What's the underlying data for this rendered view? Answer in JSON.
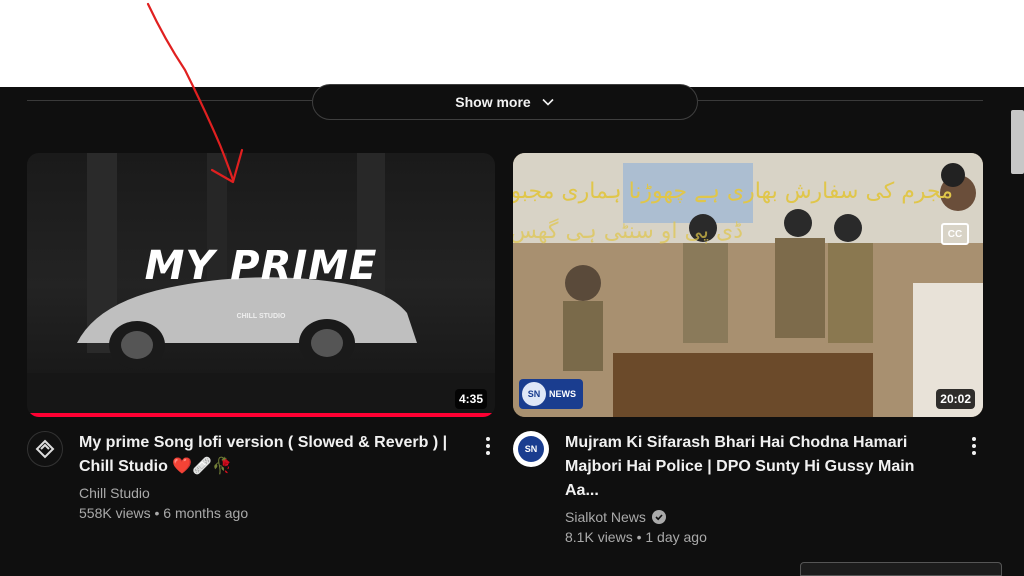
{
  "show_more": {
    "label": "Show more",
    "icon": "chevron-down-icon"
  },
  "videos": [
    {
      "thumbnail_title": "MY PRIME",
      "thumbnail_subtitle": "CHILL STUDIO",
      "duration": "4:35",
      "watched_progress_percent": 100,
      "title": "My prime Song lofi version ( Slowed & Reverb ) | Chill Studio ❤️🩹🥀",
      "channel": "Chill Studio",
      "verified": false,
      "stats": "558K views • 6 months ago"
    },
    {
      "thumbnail_text_line1": "مجرم کی سفارش بھاری ہے چھوڑنا ہماری مجبوری ہے پولیس",
      "thumbnail_text_line2": "ڈی پی او سنٹی ہی گھس گئے",
      "cc_label": "CC",
      "logo_text": "NEWS",
      "logo_abbrev": "SN",
      "duration": "20:02",
      "title": "Mujram Ki Sifarash Bhari Hai Chodna Hamari Majbori Hai Police | DPO Sunty Hi Gussy Main Aa...",
      "channel": "Sialkot News",
      "verified": true,
      "stats": "8.1K views • 1 day ago"
    }
  ],
  "colors": {
    "background": "#0f0f0f",
    "progress": "#ff0033",
    "annotation": "#e02020"
  }
}
